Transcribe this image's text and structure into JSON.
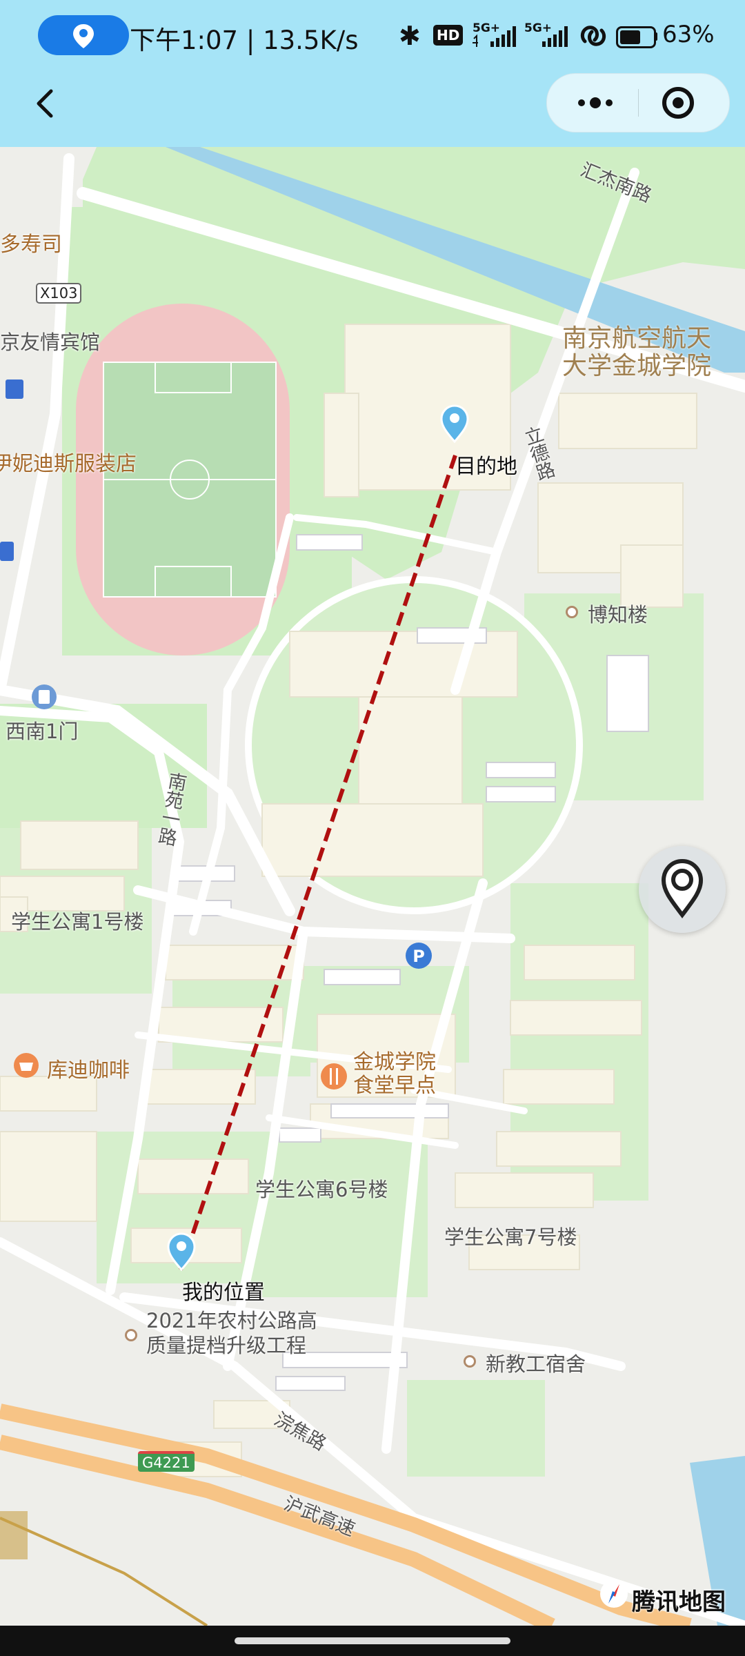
{
  "status_bar": {
    "time": "下午1:07",
    "net_speed": "13.5K/s",
    "separator": "|",
    "network_badge": "HD",
    "signal_1": "5G+",
    "signal_2": "5G+",
    "battery_percent": "63%",
    "battery_level": 0.63,
    "icons": [
      "location-icon",
      "bluetooth-icon",
      "hd-icon",
      "signal-icon",
      "wifi-link-icon",
      "battery-icon"
    ]
  },
  "nav": {
    "back_icon": "chevron-left-icon",
    "more_icon": "more-icon",
    "close_icon": "target-icon"
  },
  "map": {
    "labels": {
      "huijie_road": "汇杰南路",
      "sushi": "多寿司",
      "x103": "X103",
      "hotel": "京友情宾馆",
      "clothing": "伊妮迪斯服装店",
      "campus": "南京航空航天\n大学金城学院",
      "lide_road": "立德路",
      "destination": "目的地",
      "bozhi": "博知楼",
      "southwest_gate": "西南1门",
      "nanyuan_road": "南苑一路",
      "dorm1": "学生公寓1号楼",
      "cafe": "库迪咖啡",
      "canteen": "金城学院\n食堂早点",
      "dorm6": "学生公寓6号楼",
      "dorm7": "学生公寓7号楼",
      "my_location": "我的位置",
      "project": "2021年农村公路高\n质量提档升级工程",
      "teacher_dorm": "新教工宿舍",
      "wanjiao_road": "浣焦路",
      "g4221": "G4221",
      "huwu_highway": "沪武高速"
    },
    "provider": "腾讯地图",
    "route_color": "#b01010",
    "accent": "#1a7be6"
  }
}
